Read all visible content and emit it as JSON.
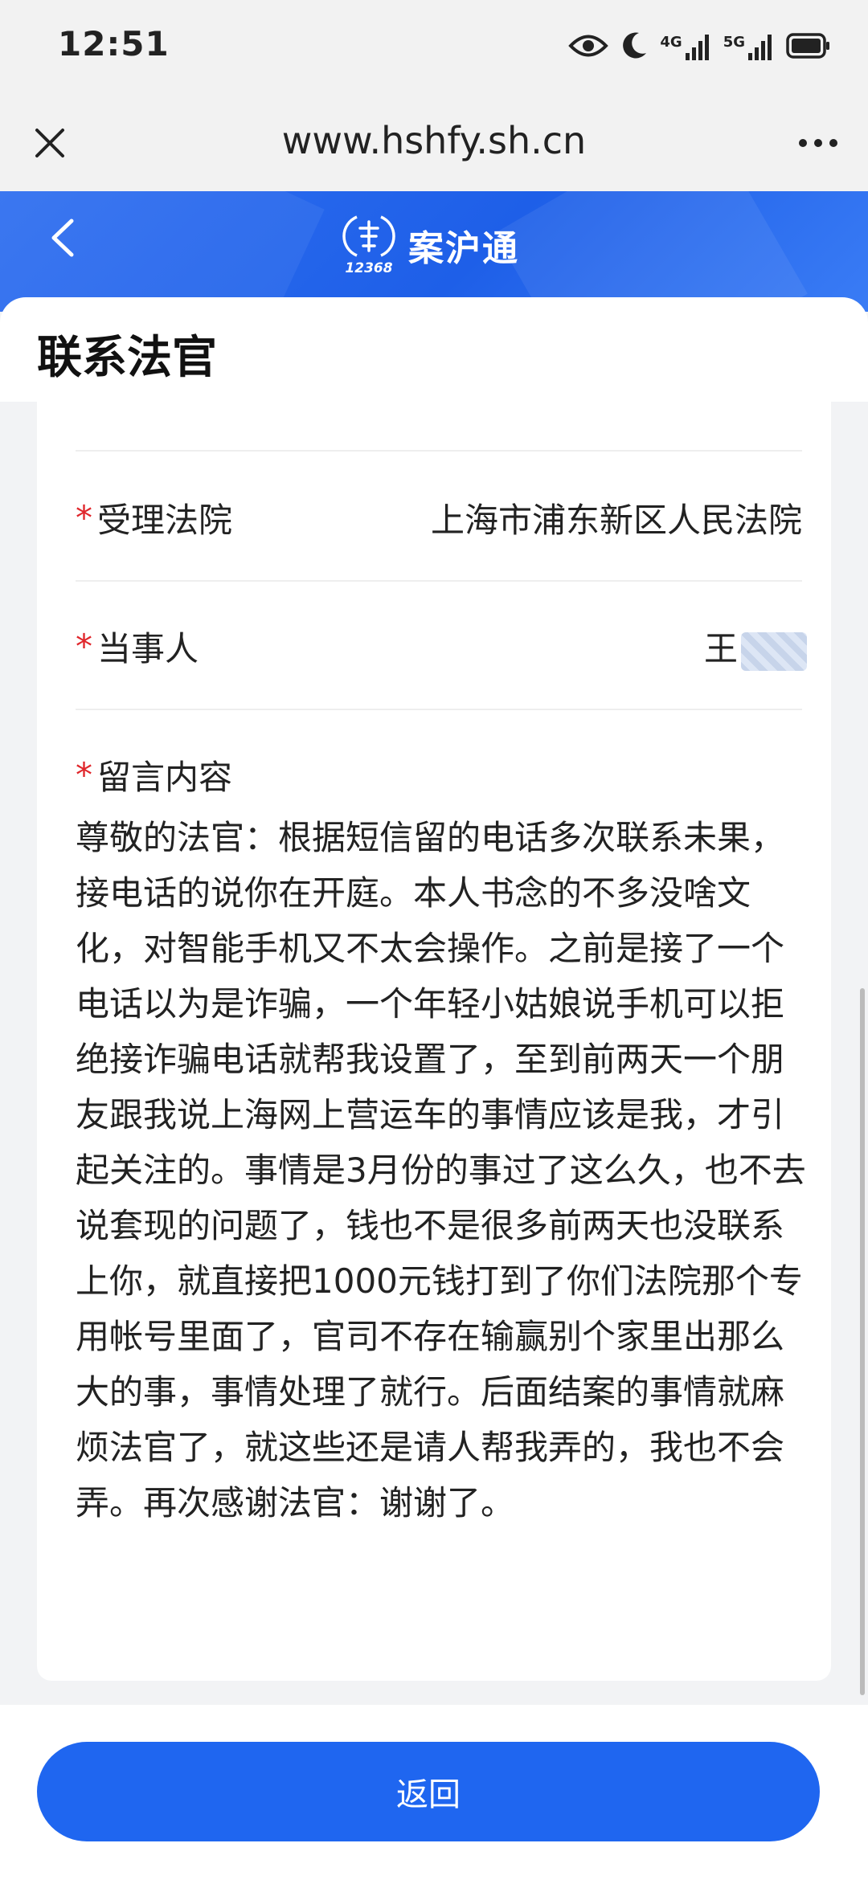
{
  "status_bar": {
    "time": "12:51",
    "network_4g": "4G",
    "network_5g": "5G",
    "icons": [
      "eye-icon",
      "moon-icon",
      "signal-4g-icon",
      "signal-5g-icon",
      "battery-icon"
    ]
  },
  "browser": {
    "url": "www.hshfy.sh.cn",
    "icons": [
      "close-icon",
      "more-icon"
    ]
  },
  "app_header": {
    "title": "案沪通",
    "logo_number": "12368",
    "accent_color": "#1f66f0"
  },
  "page": {
    "title": "联系法官"
  },
  "form": {
    "required_mark": "*",
    "court": {
      "label": "受理法院",
      "value": "上海市浦东新区人民法院"
    },
    "party": {
      "label": "当事人",
      "value": "王"
    },
    "message": {
      "label": "留言内容",
      "content": "尊敬的法官：根据短信留的电话多次联系未果，接电话的说你在开庭。本人书念的不多没啥文化，对智能手机又不太会操作。之前是接了一个电话以为是诈骗，一个年轻小姑娘说手机可以拒绝接诈骗电话就帮我设置了，至到前两天一个朋友跟我说上海网上营运车的事情应该是我，才引起关注的。事情是3月份的事过了这么久，也不去说套现的问题了，钱也不是很多前两天也没联系上你，就直接把1000元钱打到了你们法院那个专用帐号里面了，官司不存在输赢别个家里出那么大的事，事情处理了就行。后面结案的事情就麻烦法官了，就这些还是请人帮我弄的，我也不会弄。再次感谢法官：谢谢了。"
    }
  },
  "footer": {
    "return_label": "返回"
  }
}
